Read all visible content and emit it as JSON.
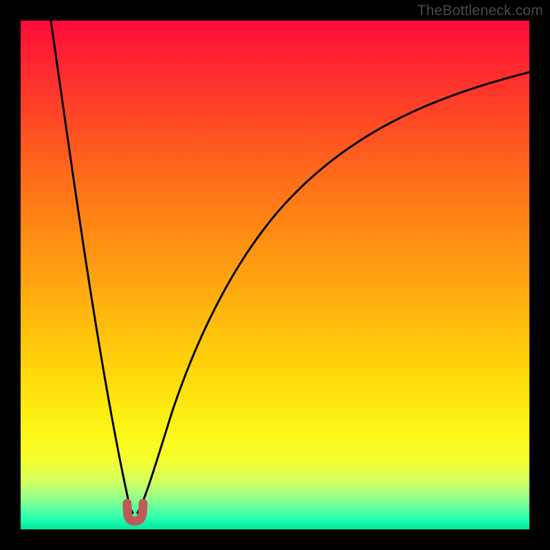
{
  "watermark": "TheBottleneck.com",
  "chart_data": {
    "type": "line",
    "title": "",
    "xlabel": "",
    "ylabel": "",
    "xlim": [
      0,
      100
    ],
    "ylim": [
      0,
      100
    ],
    "grid": false,
    "legend": false,
    "series": [
      {
        "name": "bottleneck-curve",
        "x": [
          6,
          8,
          10,
          12,
          14,
          16,
          18,
          20,
          21,
          22,
          22.5,
          23,
          24,
          26,
          30,
          35,
          40,
          45,
          50,
          55,
          60,
          65,
          70,
          75,
          80,
          85,
          90,
          95,
          100
        ],
        "y": [
          100,
          88,
          76,
          64,
          52,
          40,
          28,
          16,
          10,
          5,
          3.5,
          5,
          10,
          18,
          30,
          42,
          51,
          58,
          64,
          69,
          73,
          76.5,
          79.5,
          82,
          84,
          86,
          87.5,
          89,
          90
        ]
      }
    ],
    "marker": {
      "name": "optimal-point-marker",
      "x": 22.5,
      "y": 3.5,
      "color": "#c05a57"
    },
    "background_gradient": {
      "top_color": "#ff0a3a",
      "mid_color": "#ffd40a",
      "bottom_color": "#00e69a"
    }
  }
}
